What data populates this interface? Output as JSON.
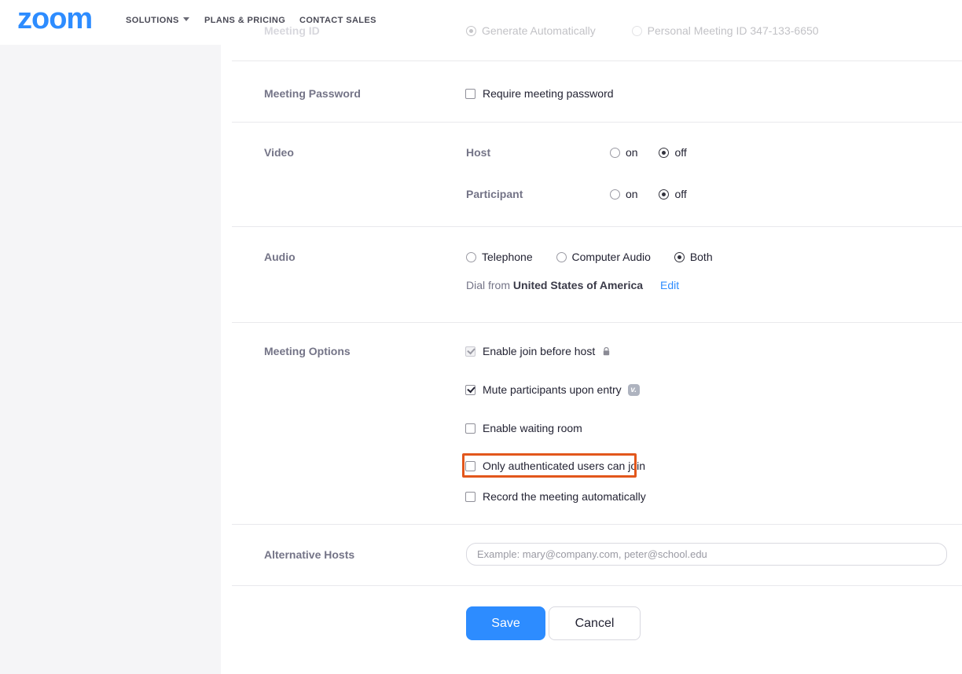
{
  "header": {
    "logo": "zoom",
    "nav": [
      {
        "label": "SOLUTIONS",
        "has_caret": true
      },
      {
        "label": "PLANS & PRICING",
        "has_caret": false
      },
      {
        "label": "CONTACT SALES",
        "has_caret": false
      }
    ]
  },
  "faded_row": {
    "label": "Meeting ID",
    "options": [
      {
        "label": "Generate Automatically",
        "selected": true
      },
      {
        "label": "Personal Meeting ID 347-133-6650",
        "selected": false
      }
    ]
  },
  "sections": {
    "meeting_password": {
      "label": "Meeting Password",
      "checkbox_label": "Require meeting password",
      "checked": false
    },
    "video": {
      "label": "Video",
      "rows": [
        {
          "label": "Host",
          "options": [
            "on",
            "off"
          ],
          "selected": "off"
        },
        {
          "label": "Participant",
          "options": [
            "on",
            "off"
          ],
          "selected": "off"
        }
      ]
    },
    "audio": {
      "label": "Audio",
      "options": [
        "Telephone",
        "Computer Audio",
        "Both"
      ],
      "selected": "Both",
      "dial_from_prefix": "Dial from",
      "dial_from_country": "United States of America",
      "edit_link": "Edit"
    },
    "meeting_options": {
      "label": "Meeting Options",
      "checkboxes": [
        {
          "label": "Enable join before host",
          "checked": true,
          "disabled": true,
          "icon": "lock-icon"
        },
        {
          "label": "Mute participants upon entry",
          "checked": true,
          "disabled": false,
          "icon": "version-badge-icon"
        },
        {
          "label": "Enable waiting room",
          "checked": false,
          "disabled": false,
          "icon": null
        },
        {
          "label": "Only authenticated users can join",
          "checked": false,
          "disabled": false,
          "icon": null,
          "highlighted": true,
          "highlight_color": "#e2571c"
        },
        {
          "label": "Record the meeting automatically",
          "checked": false,
          "disabled": false,
          "icon": null
        }
      ]
    },
    "alternative_hosts": {
      "label": "Alternative Hosts",
      "value": "",
      "placeholder": "Example: mary@company.com, peter@school.edu"
    },
    "actions": {
      "save": "Save",
      "cancel": "Cancel"
    }
  },
  "colors": {
    "brand_blue": "#2D8CFF",
    "label_gray": "#747487",
    "text_dark": "#232333",
    "highlight_orange": "#e2571c",
    "sidebar_bg": "#f5f5f7",
    "divider": "#e9e9ec"
  }
}
